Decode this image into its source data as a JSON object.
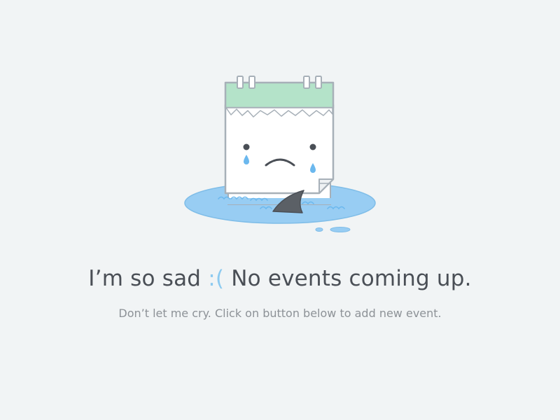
{
  "empty_state": {
    "headline_before": "I’m so sad ",
    "headline_emoticon": ":(",
    "headline_after": " No events coming up.",
    "subtext": "Don’t let me cry. Click on button below to add new event."
  },
  "illustration": {
    "icon": "sad-calendar-icon",
    "shark_fin": "shark-fin-icon",
    "colors": {
      "calendar_header": "#b4e3c9",
      "calendar_outline": "#a7b0b8",
      "puddle": "#98cdf3",
      "tear": "#6bb8ee",
      "fin": "#5b6066",
      "face": "#4a4f56"
    }
  },
  "colors": {
    "background": "#f1f4f5",
    "headline": "#4a4f56",
    "emoticon": "#8ccaf0",
    "subtext": "#8d9297"
  }
}
